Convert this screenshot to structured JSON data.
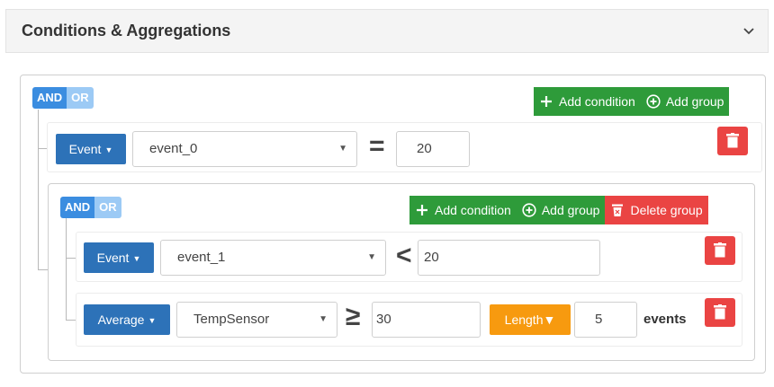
{
  "header": {
    "title": "Conditions & Aggregations"
  },
  "root": {
    "and_label": "AND",
    "or_label": "OR",
    "add_condition": "Add condition",
    "add_group": "Add group",
    "rule": {
      "type_label": "Event",
      "field": "event_0",
      "operator": "=",
      "value": "20"
    }
  },
  "group": {
    "and_label": "AND",
    "or_label": "OR",
    "add_condition": "Add condition",
    "add_group": "Add group",
    "delete_group": "Delete group",
    "rules": [
      {
        "type_label": "Event",
        "field": "event_1",
        "operator": "<",
        "value": "20"
      },
      {
        "type_label": "Average",
        "field": "TempSensor",
        "operator": "≥",
        "value": "30",
        "window_label": "Length",
        "window_value": "5",
        "window_unit": "events"
      }
    ]
  },
  "colors": {
    "primary": "#2d72b8",
    "success": "#2e9b3a",
    "danger": "#ea4443",
    "warning": "#f79a0f"
  },
  "icons": [
    "chevron-down-icon",
    "plus-icon",
    "plus-circle-icon",
    "trash-icon",
    "caret-down-icon"
  ]
}
